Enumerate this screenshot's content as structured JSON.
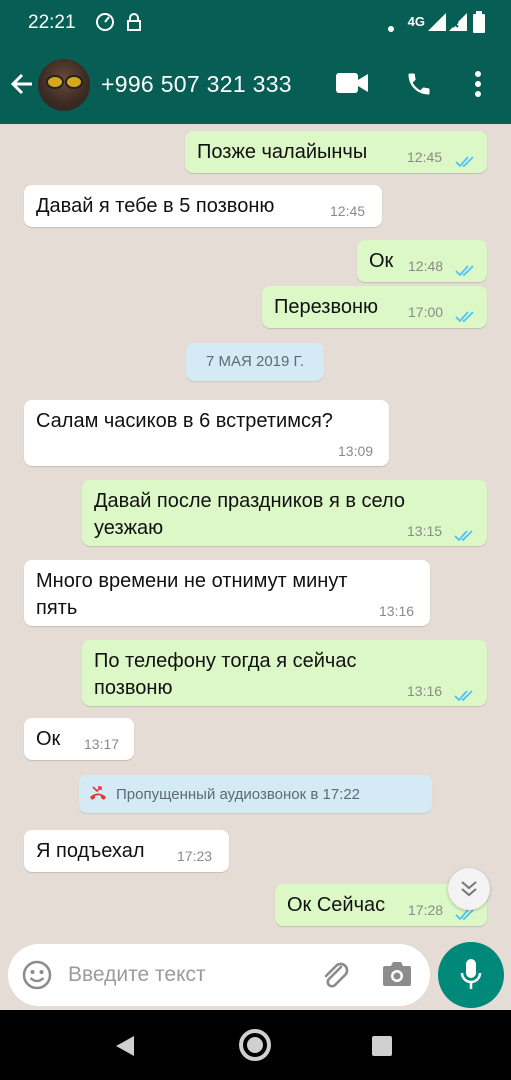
{
  "status_bar": {
    "time": "22:21",
    "network": "4G"
  },
  "header": {
    "contact": "+996 507 321 333"
  },
  "messages": [
    {
      "text": "Позже чалайынчы",
      "time": "12:45"
    },
    {
      "text": "Давай я тебе в 5 позвоню",
      "time": "12:45"
    },
    {
      "text": "Ок",
      "time": "12:48"
    },
    {
      "text": "Перезвоню",
      "time": "17:00"
    },
    {
      "text": "Салам часиков в 6 встретимся?",
      "time": "13:09"
    },
    {
      "text_line1": "Давай после праздников я в село",
      "text_line2": "уезжаю",
      "time": "13:15"
    },
    {
      "text_line1": "Много времени не отнимут минут",
      "text_line2": "пять",
      "time": "13:16"
    },
    {
      "text_line1": "По телефону тогда я сейчас",
      "text_line2": "позвоню",
      "time": "13:16"
    },
    {
      "text": "Ок",
      "time": "13:17"
    },
    {
      "text": "Я подъехал",
      "time": "17:23"
    },
    {
      "text": "Ок Сейчас",
      "time": "17:28"
    }
  ],
  "date_divider": "7 МАЯ 2019 Г.",
  "missed_call": "Пропущенный аудиозвонок в 17:22",
  "composer": {
    "placeholder": "Введите текст"
  },
  "colors": {
    "header": "#075e54",
    "outgoing": "#dcf8c6",
    "incoming": "#ffffff",
    "read_ticks": "#4fc3f7",
    "mic_button": "#00897b",
    "missed_call_icon": "#e53935"
  }
}
